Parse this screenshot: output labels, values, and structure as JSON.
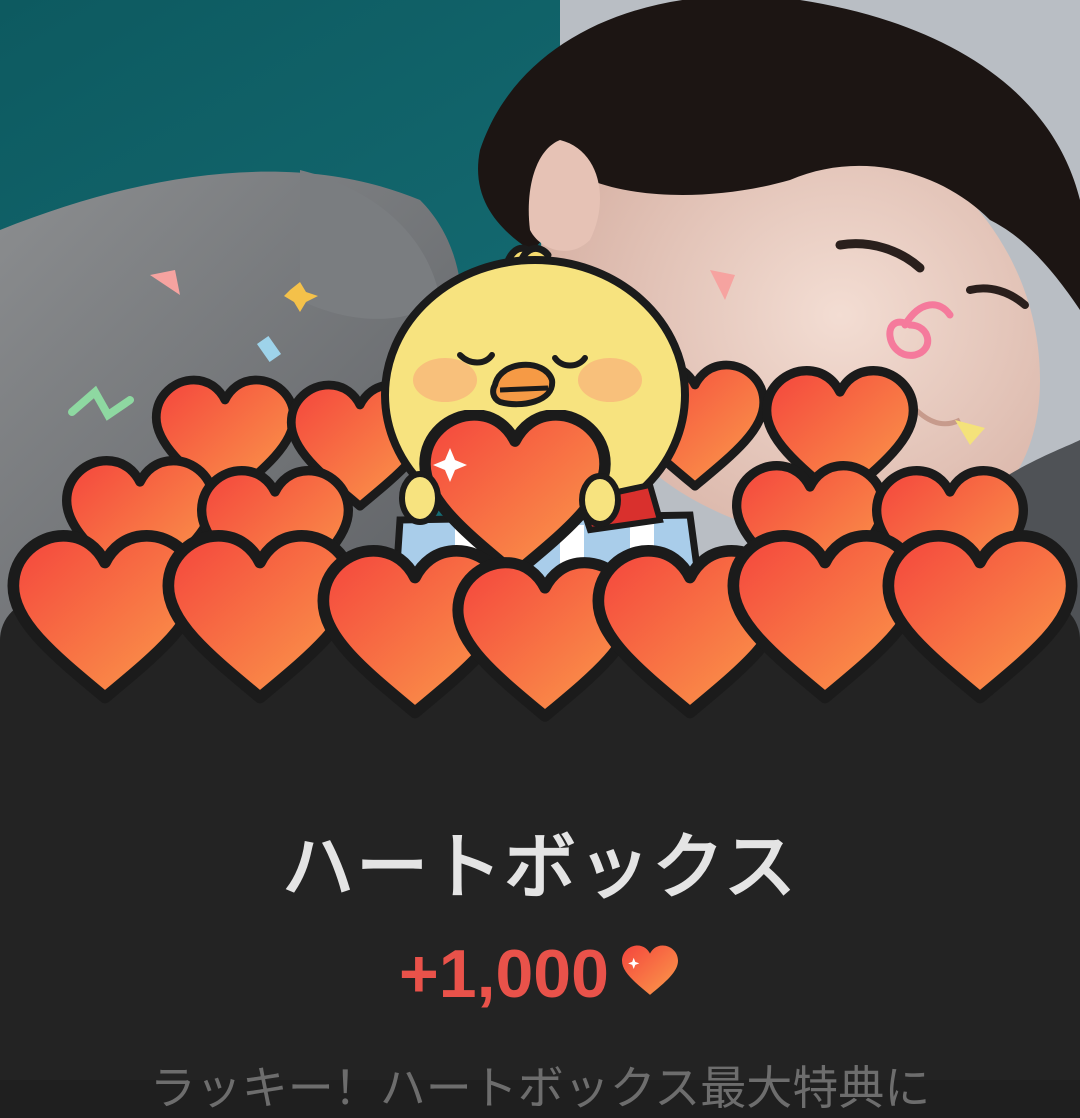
{
  "dialog": {
    "title": "ハートボックス",
    "reward_amount": "+1,000",
    "reward_icon": "heart-icon",
    "description": "ラッキー！ハートボックス最大特典に"
  },
  "colors": {
    "sheet_background": "#232323",
    "title_text": "#e4e4e4",
    "reward_text": "#e9524a",
    "heart_fill": "#f4593f"
  }
}
